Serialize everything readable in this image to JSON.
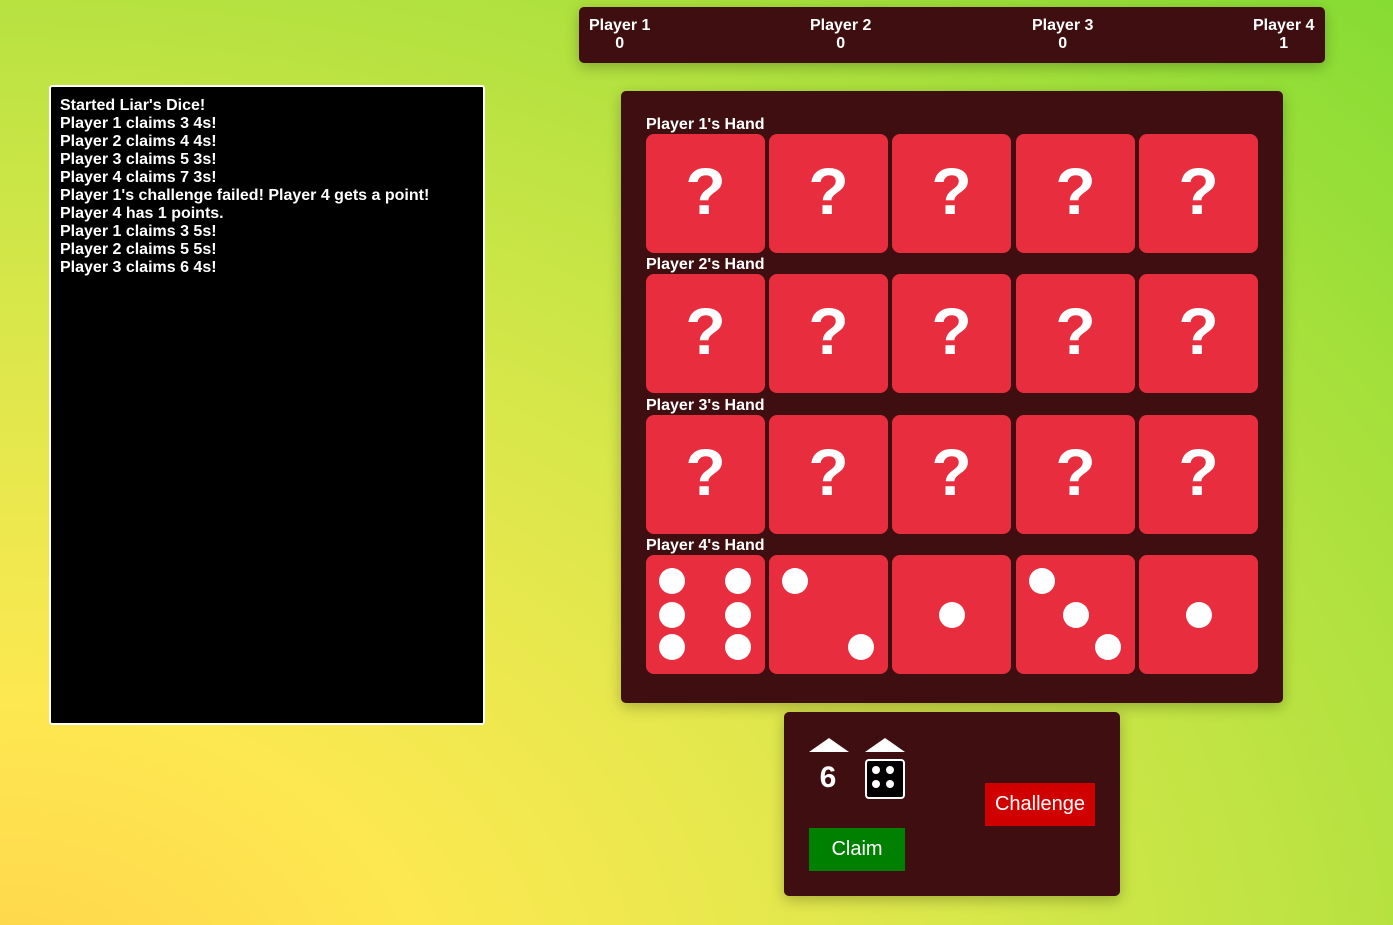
{
  "scoreboard": [
    {
      "name": "Player 1",
      "score": "0"
    },
    {
      "name": "Player 2",
      "score": "0"
    },
    {
      "name": "Player 3",
      "score": "0"
    },
    {
      "name": "Player 4",
      "score": "1"
    }
  ],
  "log": [
    "Started Liar's Dice!",
    "Player 1 claims 3 4s!",
    "Player 2 claims 4 4s!",
    "Player 3 claims 5 3s!",
    "Player 4 claims 7 3s!",
    "Player 1's challenge failed! Player 4 gets a point!",
    "Player 4 has 1 points.",
    "Player 1 claims 3 5s!",
    "Player 2 claims 5 5s!",
    "Player 3 claims 6 4s!"
  ],
  "hands": [
    {
      "label": "Player 1's Hand",
      "hidden": true,
      "dice": [
        "?",
        "?",
        "?",
        "?",
        "?"
      ]
    },
    {
      "label": "Player 2's Hand",
      "hidden": true,
      "dice": [
        "?",
        "?",
        "?",
        "?",
        "?"
      ]
    },
    {
      "label": "Player 3's Hand",
      "hidden": true,
      "dice": [
        "?",
        "?",
        "?",
        "?",
        "?"
      ]
    },
    {
      "label": "Player 4's Hand",
      "hidden": false,
      "dice": [
        6,
        2,
        1,
        3,
        1
      ]
    }
  ],
  "claim": {
    "quantity": "6",
    "face": 4,
    "claim_label": "Claim",
    "challenge_label": "Challenge"
  },
  "colors": {
    "panel": "#3f0e11",
    "die": "#e82e3e",
    "claim_button": "#008000",
    "challenge_button": "#d10000"
  },
  "icons": {
    "quantity_increment": "triangle-up-icon",
    "face_increment": "triangle-up-icon",
    "claim_face": "die-face-icon"
  }
}
